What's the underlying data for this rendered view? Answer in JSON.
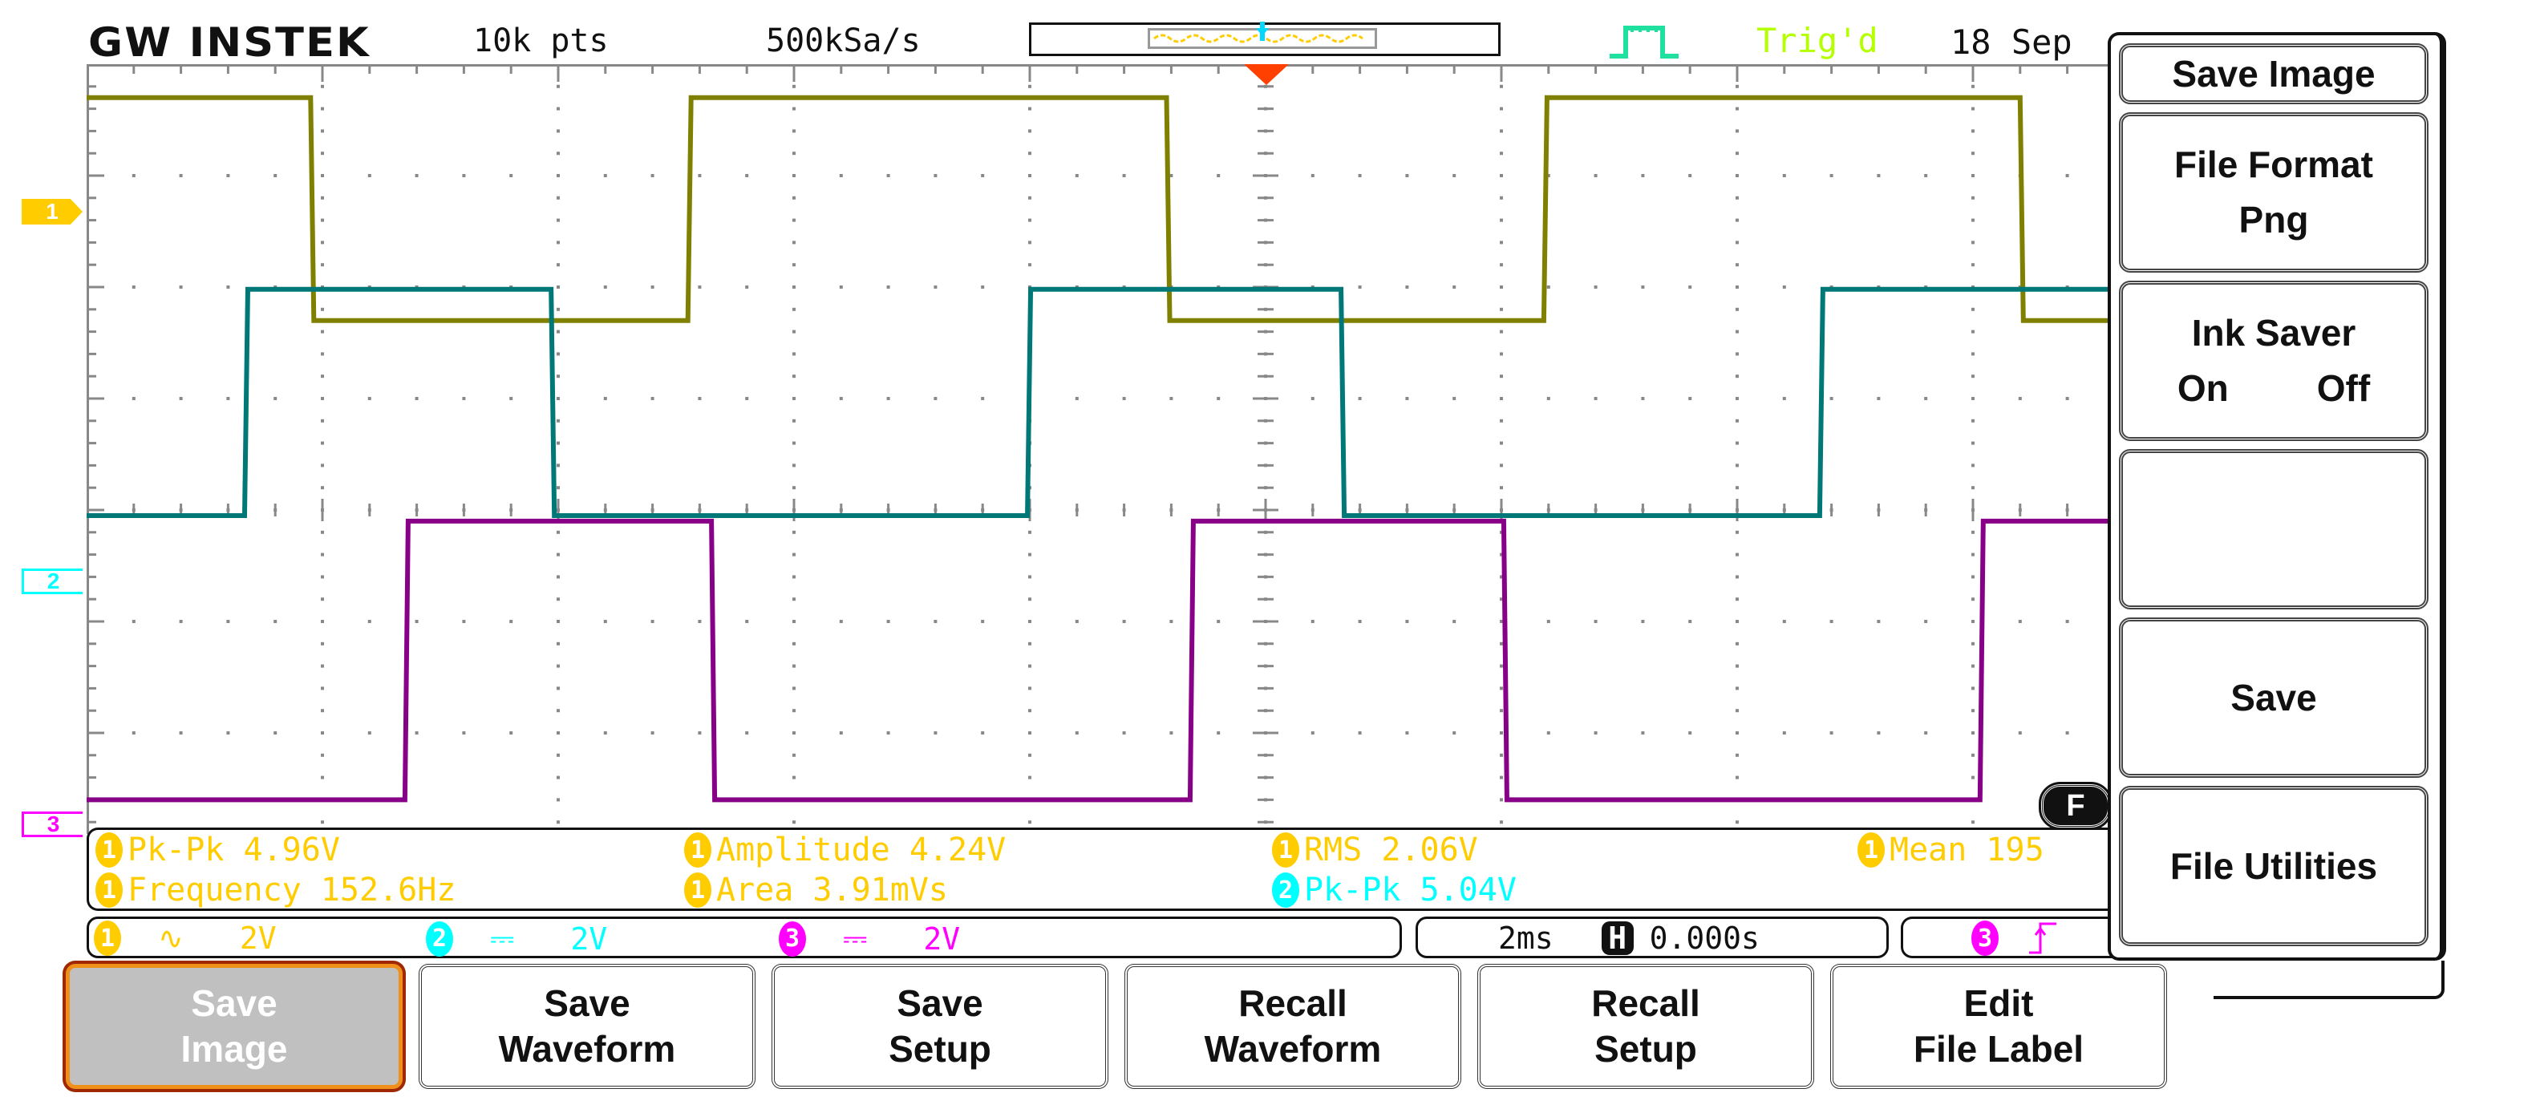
{
  "header": {
    "logo": "GW INSTEK",
    "record_length": "10k pts",
    "sample_rate": "500kSa/s",
    "trigger_status": "Trig'd",
    "date": "18 Sep"
  },
  "colors": {
    "ch1": "#ffcc00",
    "ch1_trace": "#808000",
    "ch2": "#00ffff",
    "ch2_trace": "#007878",
    "ch3": "#ff00ff",
    "ch3_trace": "#880088",
    "trigger_marker": "#ff4000",
    "trig_status": "#b4ff00",
    "trig_icon": "#20e0a0",
    "grid": "#888888"
  },
  "channel_markers": [
    {
      "label": "1"
    },
    {
      "label": "2"
    },
    {
      "label": "3"
    }
  ],
  "measurements": [
    {
      "channel": "1",
      "text": "Pk-Pk 4.96V"
    },
    {
      "channel": "1",
      "text": "Amplitude 4.24V"
    },
    {
      "channel": "1",
      "text": "RMS 2.06V"
    },
    {
      "channel": "1",
      "text": "Mean 195"
    },
    {
      "channel": "1",
      "text": "Frequency 152.6Hz"
    },
    {
      "channel": "1",
      "text": "Area 3.91mVs"
    },
    {
      "channel": "2",
      "text": "Pk-Pk 5.04V"
    }
  ],
  "status_bar": {
    "channels": [
      {
        "channel": "1",
        "coupling_symbol": "∿",
        "coupling": "AC",
        "scale": "2V"
      },
      {
        "channel": "2",
        "coupling_symbol": "⎓",
        "coupling": "DC",
        "scale": "2V"
      },
      {
        "channel": "3",
        "coupling_symbol": "⎓",
        "coupling": "DC",
        "scale": "2V"
      }
    ],
    "timebase": "2ms",
    "h_position_icon": "H",
    "h_position": "0.000s",
    "trigger_source": "3",
    "trigger_slope_icon": "rising-edge"
  },
  "f_indicator": "F",
  "side_menu": {
    "title": "Save Image",
    "items": [
      {
        "line1": "File Format",
        "line2": "Png"
      },
      {
        "line1": "Ink Saver",
        "line2_left": "On",
        "line2_right": "Off"
      },
      {
        "line1": "",
        "line2": ""
      },
      {
        "line1": "Save",
        "line2": ""
      },
      {
        "line1": "File Utilities",
        "line2": ""
      }
    ]
  },
  "softkeys": [
    {
      "line1": "Save",
      "line2": "Image",
      "active": true
    },
    {
      "line1": "Save",
      "line2": "Waveform",
      "active": false
    },
    {
      "line1": "Save",
      "line2": "Setup",
      "active": false
    },
    {
      "line1": "Recall",
      "line2": "Waveform",
      "active": false
    },
    {
      "line1": "Recall",
      "line2": "Setup",
      "active": false
    },
    {
      "line1": "Edit",
      "line2": "File Label",
      "active": false
    }
  ],
  "waveforms": {
    "time_per_div_ms": 2,
    "h_divisions": 10,
    "v_divisions": 8,
    "traces": [
      {
        "channel": "1",
        "name": "CH1",
        "high_div": 3.7,
        "low_div": 1.7,
        "first_level": "high",
        "edges_div": [
          -4.05,
          -2.45,
          -0.42,
          1.18,
          3.2
        ]
      },
      {
        "channel": "2",
        "name": "CH2",
        "high_div": 1.98,
        "low_div": -0.05,
        "first_level": "low",
        "edges_div": [
          -4.33,
          -3.03,
          -1.01,
          0.32,
          2.35
        ]
      },
      {
        "channel": "3",
        "name": "CH3",
        "high_div": -0.1,
        "low_div": -2.6,
        "first_level": "low",
        "edges_div": [
          -3.65,
          -2.35,
          -0.32,
          1.01,
          3.03
        ]
      }
    ]
  }
}
